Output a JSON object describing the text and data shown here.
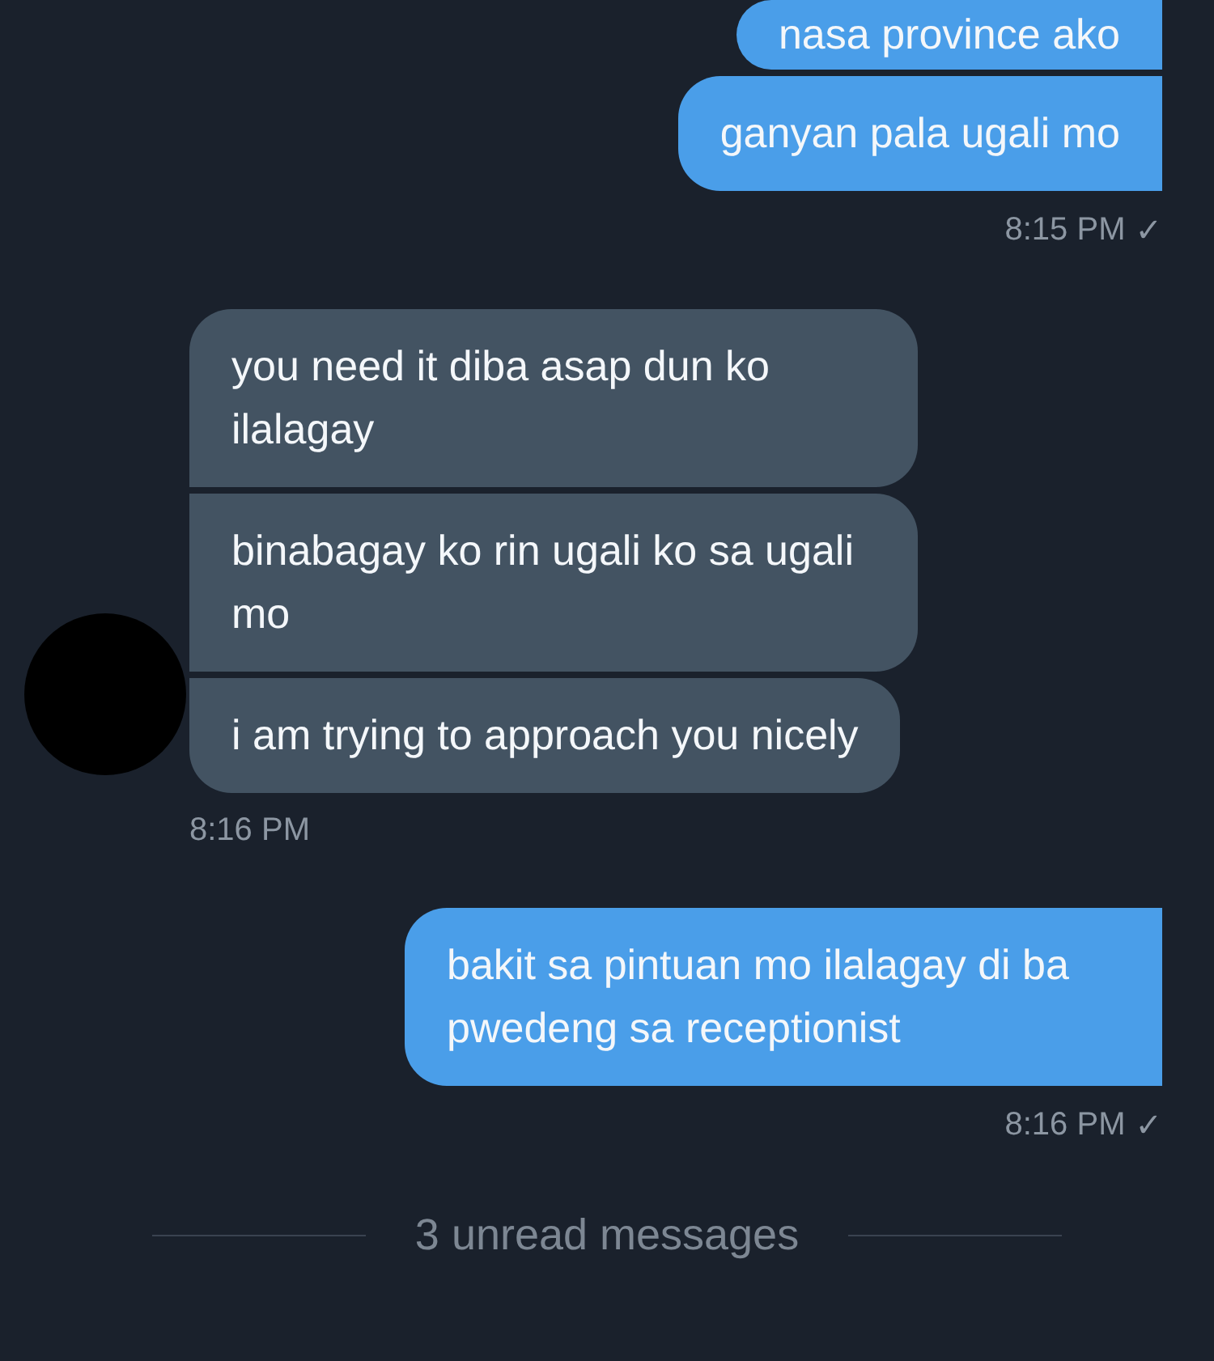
{
  "groups": [
    {
      "outgoing": true,
      "messages": [
        "nasa province ako",
        "ganyan pala ugali mo"
      ],
      "time": "8:15 PM",
      "receipt": "✓"
    },
    {
      "outgoing": false,
      "avatar": true,
      "messages": [
        "you need it diba asap dun ko ilalagay",
        "binabagay ko rin ugali ko sa ugali mo",
        "i am trying to approach you nicely"
      ],
      "time": "8:16 PM"
    },
    {
      "outgoing": true,
      "messages": [
        "bakit sa pintuan mo ilalagay di ba pwedeng sa receptionist"
      ],
      "time": "8:16 PM",
      "receipt": "✓"
    }
  ],
  "unread_divider": {
    "label": "3 unread messages"
  }
}
